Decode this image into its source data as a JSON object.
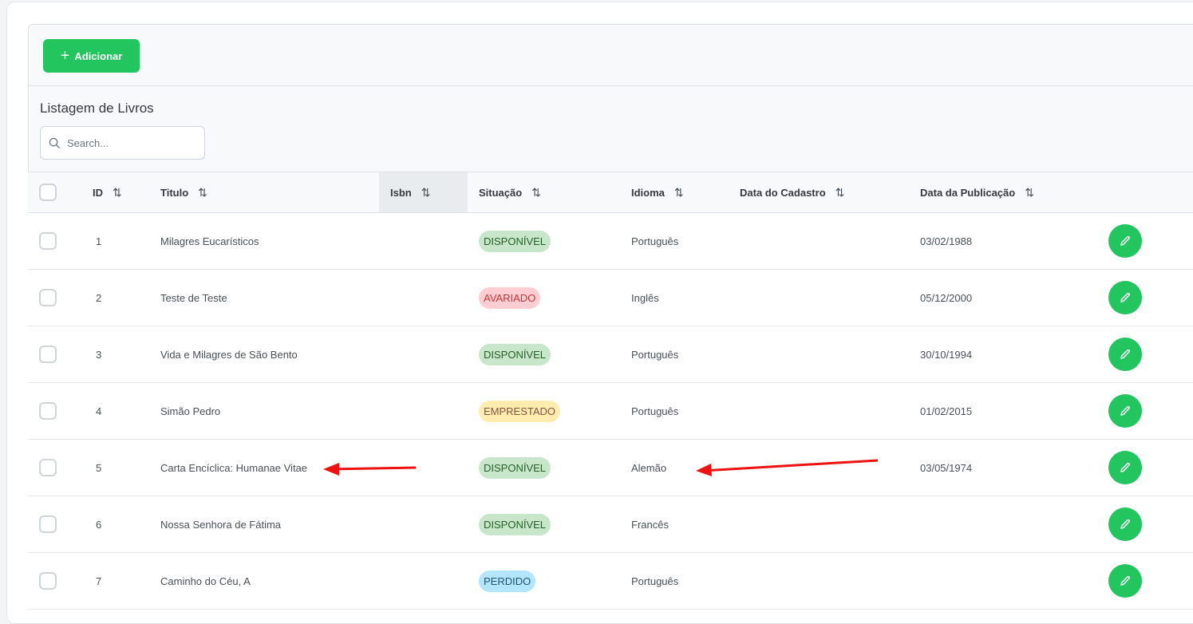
{
  "toolbar": {
    "add_label": "Adicionar"
  },
  "listing": {
    "title": "Listagem de Livros",
    "search_placeholder": "Search..."
  },
  "columns": [
    "ID",
    "Titulo",
    "Isbn",
    "Situação",
    "Idioma",
    "Data do Cadastro",
    "Data da Publicação"
  ],
  "status_colors": {
    "DISPONÍVEL": {
      "bg": "#c8e6c9",
      "fg": "#256029"
    },
    "AVARIADO": {
      "bg": "#ffcdd2",
      "fg": "#c63737"
    },
    "EMPRESTADO": {
      "bg": "#feedaf",
      "fg": "#8a5340"
    },
    "PERDIDO": {
      "bg": "#b3e5fc",
      "fg": "#23547b"
    }
  },
  "rows": [
    {
      "id": "1",
      "titulo": "Milagres Eucarísticos",
      "isbn": "",
      "situacao": "DISPONÍVEL",
      "idioma": "Português",
      "cadastro": "",
      "publicacao": "03/02/1988"
    },
    {
      "id": "2",
      "titulo": "Teste de Teste",
      "isbn": "",
      "situacao": "AVARIADO",
      "idioma": "Inglês",
      "cadastro": "",
      "publicacao": "05/12/2000"
    },
    {
      "id": "3",
      "titulo": "Vida e Milagres de São Bento",
      "isbn": "",
      "situacao": "DISPONÍVEL",
      "idioma": "Português",
      "cadastro": "",
      "publicacao": "30/10/1994"
    },
    {
      "id": "4",
      "titulo": "Simão Pedro",
      "isbn": "",
      "situacao": "EMPRESTADO",
      "idioma": "Português",
      "cadastro": "",
      "publicacao": "01/02/2015"
    },
    {
      "id": "5",
      "titulo": "Carta Encíclica: Humanae Vitae",
      "isbn": "",
      "situacao": "DISPONÍVEL",
      "idioma": "Alemão",
      "cadastro": "",
      "publicacao": "03/05/1974"
    },
    {
      "id": "6",
      "titulo": "Nossa Senhora de Fátima",
      "isbn": "",
      "situacao": "DISPONÍVEL",
      "idioma": "Francês",
      "cadastro": "",
      "publicacao": ""
    },
    {
      "id": "7",
      "titulo": "Caminho do Céu, A",
      "isbn": "",
      "situacao": "PERDIDO",
      "idioma": "Português",
      "cadastro": "",
      "publicacao": ""
    }
  ]
}
